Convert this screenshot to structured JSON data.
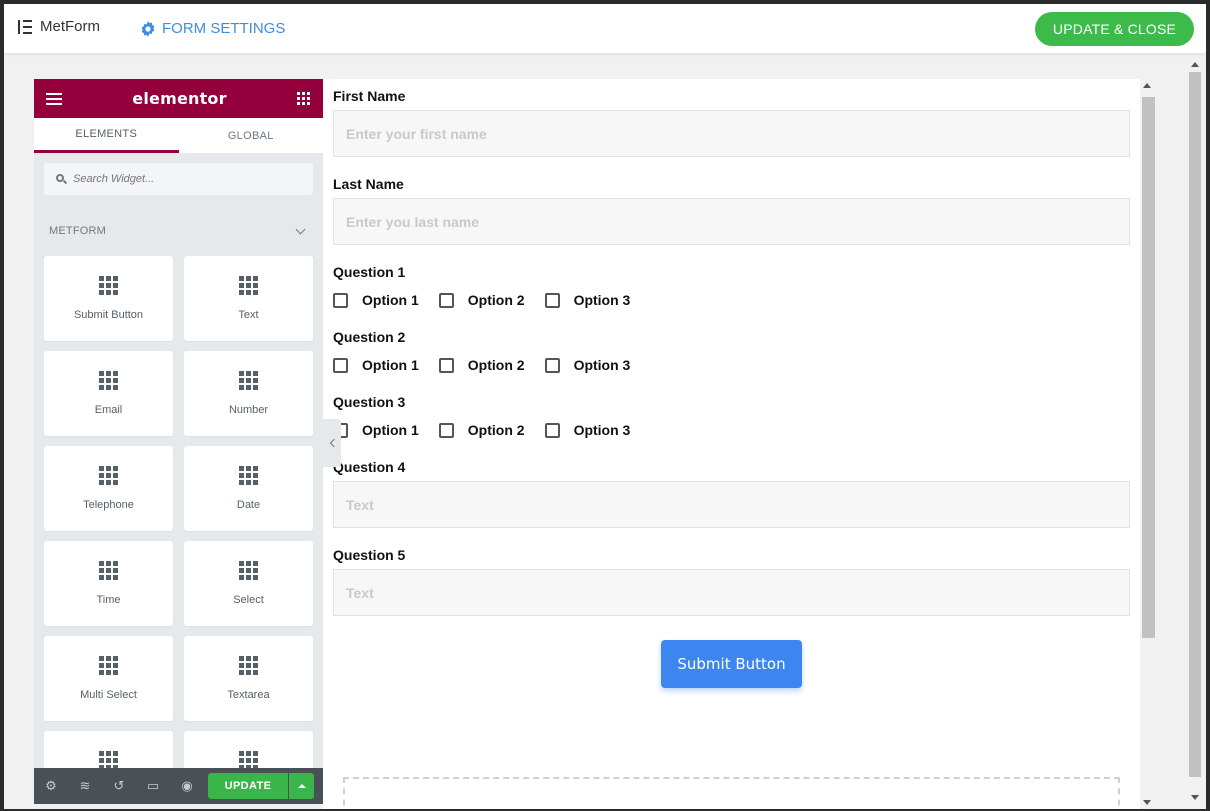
{
  "topbar": {
    "app_name": "MetForm",
    "form_settings_label": "FORM SETTINGS",
    "update_close_label": "UPDATE & CLOSE"
  },
  "panel": {
    "logo": "elementor",
    "tabs": [
      "ELEMENTS",
      "GLOBAL"
    ],
    "search_placeholder": "Search Widget...",
    "section_title": "METFORM",
    "widgets": [
      "Submit Button",
      "Text",
      "Email",
      "Number",
      "Telephone",
      "Date",
      "Time",
      "Select",
      "Multi Select",
      "Textarea",
      "",
      ""
    ],
    "update_label": "UPDATE"
  },
  "form": {
    "first_name": {
      "label": "First Name",
      "placeholder": "Enter your first name"
    },
    "last_name": {
      "label": "Last Name",
      "placeholder": "Enter you last name"
    },
    "q1": {
      "label": "Question 1",
      "options": [
        "Option 1",
        "Option 2",
        "Option 3"
      ]
    },
    "q2": {
      "label": "Question 2",
      "options": [
        "Option 1",
        "Option 2",
        "Option 3"
      ]
    },
    "q3": {
      "label": "Question 3",
      "options": [
        "Option 1",
        "Option 2",
        "Option 3"
      ]
    },
    "q4": {
      "label": "Question 4",
      "placeholder": "Text"
    },
    "q5": {
      "label": "Question 5",
      "placeholder": "Text"
    },
    "submit_label": "Submit Button"
  },
  "colors": {
    "elementor_brand": "#93003c",
    "update_green": "#3cba4a",
    "submit_blue": "#3d86f0",
    "settings_blue": "#3a8fe0"
  }
}
